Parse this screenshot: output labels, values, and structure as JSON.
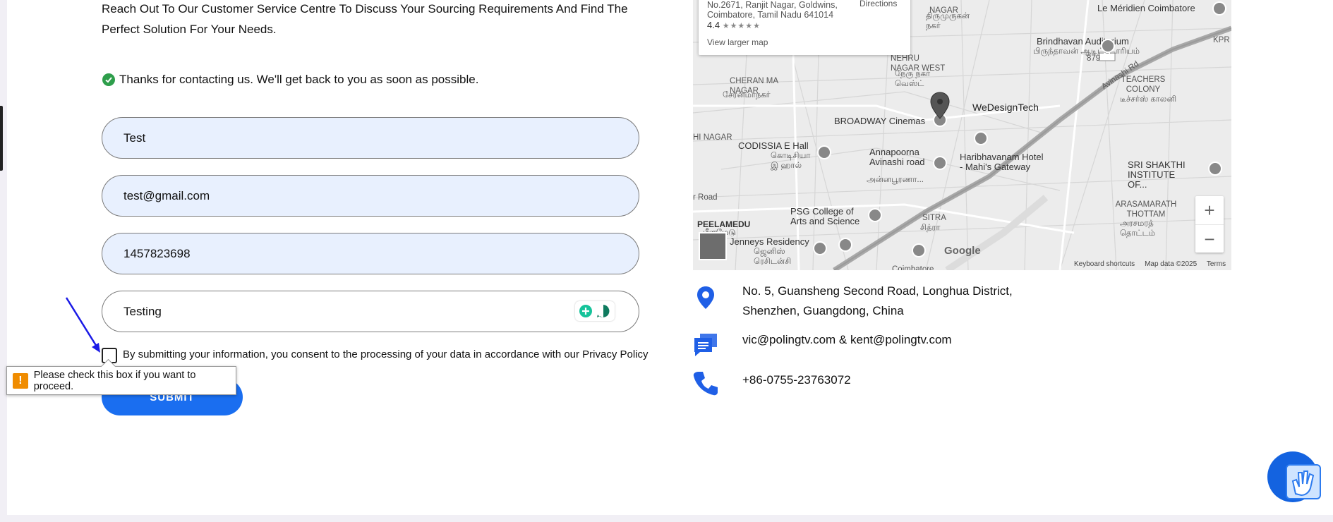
{
  "intro": {
    "text": "Reach Out To Our Customer Service Centre To Discuss Your Sourcing Requirements And Find The Perfect Solution For Your Needs."
  },
  "success": {
    "message": "Thanks for contacting us. We'll get back to you as soon as possible."
  },
  "form": {
    "name_value": "Test",
    "email_value": "test@gmail.com",
    "phone_value": "1457823698",
    "message_value": "Testing",
    "consent_text": "By submitting your information, you consent to the processing of your data in accordance with our Privacy Policy",
    "submit_label": "SUBMIT",
    "validation_message": "Please check this box if you want to proceed."
  },
  "map": {
    "card_address": "No.2671, Ranjit Nagar, Goldwins, Coimbatore, Tamil Nadu 641014",
    "card_rating": "4.4",
    "card_stars": "★★★★★",
    "card_larger_map": "View larger map",
    "card_directions": "Directions",
    "pin_label": "WeDesignTech",
    "labels": {
      "meridien": "Le Méridien Coimbatore",
      "brindhavan": "Brindhavan Auditorium",
      "brindhavan_ta": "பிருந்தாவன் ஆடிட்டோரியம்",
      "thirumurugan": "திருமுருகன் நகர்",
      "nehru": "NEHRU NAGAR WEST",
      "nehru_ta": "நேரு நகர் வெஸ்ட்",
      "cheran": "CHERAN MA NAGAR",
      "cheran_ta": "சேரன்மாநகர்",
      "broadway": "BROADWAY Cinemas",
      "codissia": "CODISSIA E Hall",
      "codissia_ta": "கொடிசியா இ ஹால்",
      "annapoorna": "Annapoorna Avinashi road",
      "annapoorna_ta": "அன்னபூரணா...",
      "haribhavanam": "Haribhavanam Hotel - Mahi's Gateway",
      "teachers": "TEACHERS COLONY",
      "teachers_ta": "டீச்சர்ஸ் காலனி",
      "shakthi": "SRI SHAKTHI INSTITUTE OF...",
      "psg": "PSG College of Arts and Science",
      "sitra": "SITRA",
      "sitra_ta": "சித்ரா",
      "arasamarath": "ARASAMARATH THOTTAM",
      "arasamarath_ta": "அரசமரத் தொட்டம்",
      "peelamedu": "PEELAMEDU",
      "peelamedu_ta": "பீளமேடு",
      "jenneys": "Jenneys Residency",
      "jenneys_ta": "ஜெனிஸ் ரெசிடன்சி",
      "coimbatore": "Coimbatore",
      "avinashi_rd": "Avinashi Rd",
      "road_879": "879",
      "kpr": "KPR",
      "hi_nagar": "HI NAGAR",
      "nagar_top": "NAGAR",
      "f_road": "r Road"
    },
    "google_logo": "Google",
    "footer_shortcuts": "Keyboard shortcuts",
    "footer_data": "Map data ©2025",
    "footer_terms": "Terms"
  },
  "contact": {
    "address_line1": "No. 5, Guansheng Second Road, Longhua District,",
    "address_line2": "Shenzhen, Guangdong, China",
    "email": "vic@polingtv.com & kent@polingtv.com",
    "phone": "+86-0755-23763072"
  },
  "colors": {
    "accent": "#1a6ef0",
    "field_bg": "#e8f0fe",
    "success": "#2e9e4b",
    "warning": "#f08c00"
  }
}
